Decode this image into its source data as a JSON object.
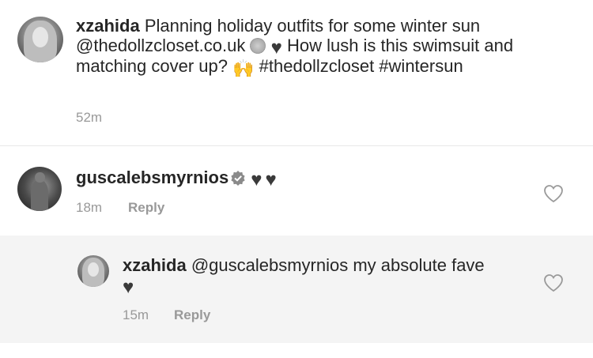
{
  "post": {
    "username": "xzahida",
    "text_part1": "Planning holiday outfits for some winter sun @thedollzcloset.co.uk",
    "text_part2": "How lush is this swimsuit and matching cover up?",
    "text_part3": "#thedollzcloset #wintersun",
    "time": "52m"
  },
  "comments": [
    {
      "username": "guscalebsmyrnios",
      "text": "",
      "time": "18m",
      "reply_label": "Reply",
      "hearts": "♥♥"
    },
    {
      "username": "xzahida",
      "text": "@guscalebsmyrnios my absolute fave",
      "heart": "♥",
      "time": "15m",
      "reply_label": "Reply"
    }
  ],
  "colors": {
    "text": "#262626",
    "muted": "#999999",
    "divider": "#e8e8e8",
    "reply_bg": "#f4f4f4"
  }
}
